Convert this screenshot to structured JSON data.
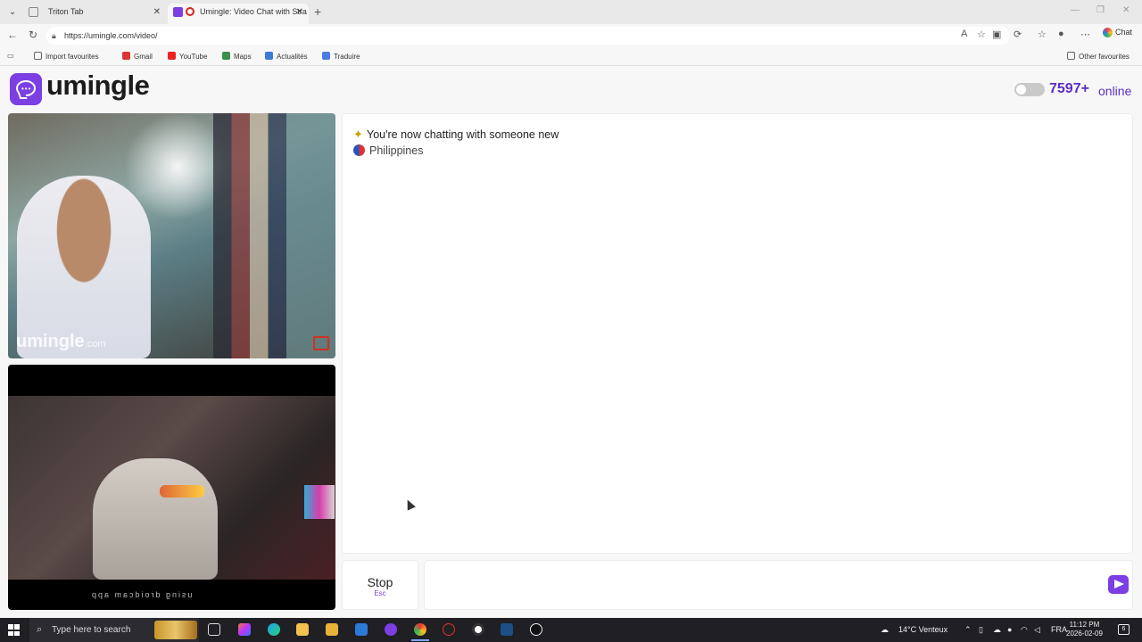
{
  "browser": {
    "tabs": [
      {
        "title": "Triton Tab",
        "active": false
      },
      {
        "title": "Umingle: Video Chat with Stra",
        "active": true
      }
    ],
    "url": "https://umingle.com/video/",
    "chat_label": "Chat",
    "bookmarks": [
      {
        "label": "Import favourites",
        "icon": "import-icon"
      },
      {
        "label": "Gmail",
        "icon": "gmail-icon"
      },
      {
        "label": "YouTube",
        "icon": "youtube-icon"
      },
      {
        "label": "Maps",
        "icon": "maps-icon"
      },
      {
        "label": "Actualités",
        "icon": "news-icon"
      },
      {
        "label": "Traduire",
        "icon": "translate-icon"
      }
    ],
    "other_favourites": "Other favourites"
  },
  "site": {
    "brand": "umingle",
    "online_count": "7597+",
    "online_label": "online",
    "brand_color": "#7b3fe4"
  },
  "videos": {
    "watermark_brand": "umingle",
    "watermark_domain": ".com",
    "self_caption": "using droidcam app"
  },
  "chat": {
    "system_message": "You're now chatting with someone new",
    "country": "Philippines",
    "input_value": "",
    "stop_label": "Stop",
    "stop_shortcut": "Esc"
  },
  "taskbar": {
    "search_placeholder": "Type here to search",
    "weather": "14°C Venteux",
    "language": "FRA",
    "time": "11:12 PM",
    "date": "2026-02-09",
    "notifications": "6"
  }
}
